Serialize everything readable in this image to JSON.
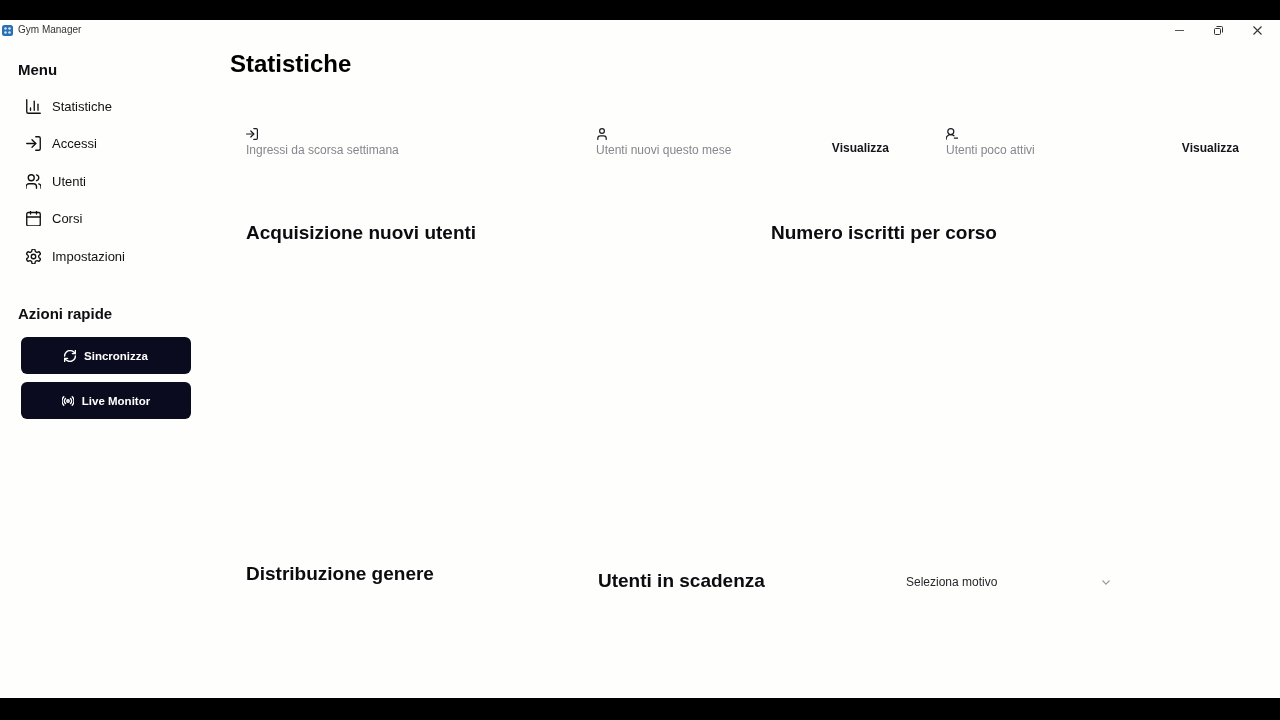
{
  "window": {
    "title": "Gym Manager"
  },
  "sidebar": {
    "menu_title": "Menu",
    "items": [
      {
        "label": "Statistiche",
        "kind": "chart"
      },
      {
        "label": "Accessi",
        "kind": "login"
      },
      {
        "label": "Utenti",
        "kind": "users"
      },
      {
        "label": "Corsi",
        "kind": "calendar"
      },
      {
        "label": "Impostazioni",
        "kind": "settings"
      }
    ],
    "quick_actions": {
      "title": "Azioni rapide",
      "buttons": [
        {
          "label": "Sincronizza",
          "kind": "sync"
        },
        {
          "label": "Live Monitor",
          "kind": "broadcast"
        }
      ]
    }
  },
  "page": {
    "title": "Statistiche",
    "stat_cards": [
      {
        "kind": "login",
        "label": "Ingressi da scorsa settimana"
      },
      {
        "kind": "user",
        "label": "Utenti nuovi questo mese",
        "action": "Visualizza"
      },
      {
        "kind": "user-minus",
        "label": "Utenti poco attivi",
        "action": "Visualizza"
      }
    ],
    "sections": [
      {
        "title": "Acquisizione nuovi utenti"
      },
      {
        "title": "Numero iscritti per corso"
      },
      {
        "title": "Distribuzione genere"
      },
      {
        "title": "Utenti in scadenza",
        "filter": {
          "placeholder": "Seleziona motivo"
        }
      }
    ]
  }
}
